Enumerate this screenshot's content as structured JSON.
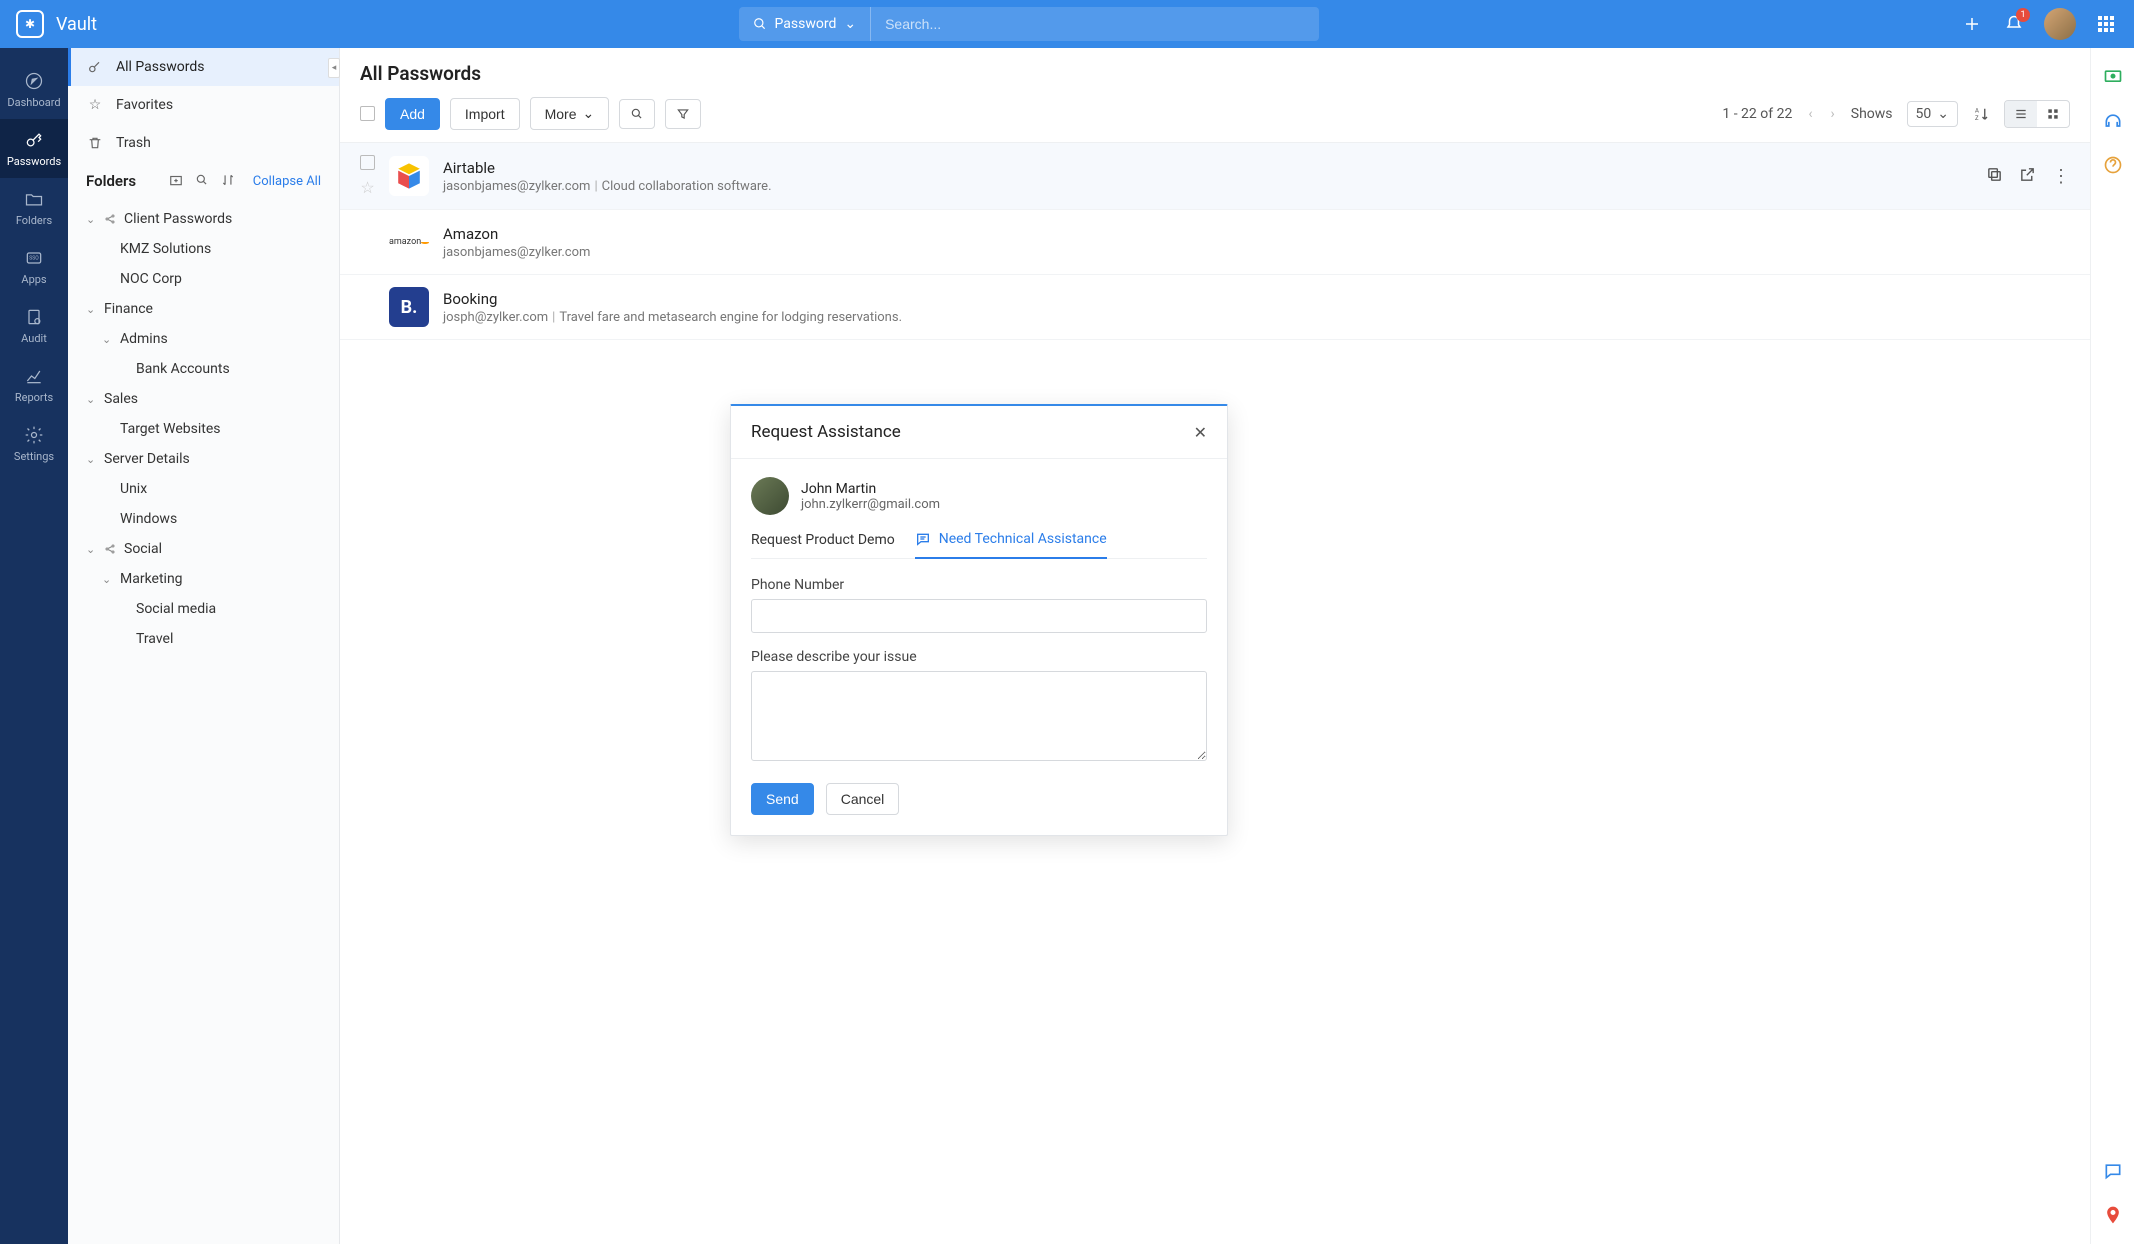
{
  "app": {
    "name": "Vault"
  },
  "topbar": {
    "search_type": "Password",
    "search_placeholder": "Search...",
    "notification_count": "1"
  },
  "rail": [
    {
      "label": "Dashboard"
    },
    {
      "label": "Passwords"
    },
    {
      "label": "Folders"
    },
    {
      "label": "Apps"
    },
    {
      "label": "Audit"
    },
    {
      "label": "Reports"
    },
    {
      "label": "Settings"
    }
  ],
  "sidebar": {
    "all_passwords": "All Passwords",
    "favorites": "Favorites",
    "trash": "Trash",
    "folders_title": "Folders",
    "collapse_all": "Collapse All",
    "tree": [
      {
        "label": "Client Passwords",
        "depth": 0,
        "shared": true,
        "expanded": true
      },
      {
        "label": "KMZ Solutions",
        "depth": 1,
        "leaf": true
      },
      {
        "label": "NOC Corp",
        "depth": 1,
        "leaf": true
      },
      {
        "label": "Finance",
        "depth": 0,
        "expanded": true
      },
      {
        "label": "Admins",
        "depth": 1,
        "expanded": true
      },
      {
        "label": "Bank Accounts",
        "depth": 2,
        "leaf": true
      },
      {
        "label": "Sales",
        "depth": 0,
        "expanded": true
      },
      {
        "label": "Target Websites",
        "depth": 1,
        "leaf": true
      },
      {
        "label": "Server Details",
        "depth": 0,
        "expanded": true
      },
      {
        "label": "Unix",
        "depth": 1,
        "leaf": true
      },
      {
        "label": "Windows",
        "depth": 1,
        "leaf": true
      },
      {
        "label": "Social",
        "depth": 0,
        "shared": true,
        "expanded": true
      },
      {
        "label": "Marketing",
        "depth": 1,
        "expanded": true
      },
      {
        "label": "Social media",
        "depth": 2,
        "leaf": true
      },
      {
        "label": "Travel",
        "depth": 2,
        "leaf": true
      }
    ]
  },
  "main": {
    "title": "All Passwords",
    "buttons": {
      "add": "Add",
      "import": "Import",
      "more": "More"
    },
    "pager": {
      "text": "1 - 22 of 22",
      "shows": "Shows",
      "page_size": "50"
    },
    "rows": [
      {
        "name": "Airtable",
        "user": "jasonbjames@zylker.com",
        "desc": "Cloud collaboration software.",
        "logo_bg": "#fff",
        "logo_txt": "",
        "highlight": true
      },
      {
        "name": "Amazon",
        "user": "jasonbjames@zylker.com",
        "desc": "",
        "logo_bg": "#fff",
        "logo_txt": "amazon"
      },
      {
        "name": "Booking",
        "user": "josph@zylker.com",
        "desc": "Travel fare and metasearch engine for lodging reservations.",
        "logo_bg": "#233e8f",
        "logo_txt": "B."
      }
    ]
  },
  "modal": {
    "title": "Request Assistance",
    "user_name": "John Martin",
    "user_email": "john.zylkerr@gmail.com",
    "tab1": "Request Product Demo",
    "tab2": "Need Technical Assistance",
    "phone_label": "Phone Number",
    "desc_label": "Please describe your issue",
    "send": "Send",
    "cancel": "Cancel"
  }
}
